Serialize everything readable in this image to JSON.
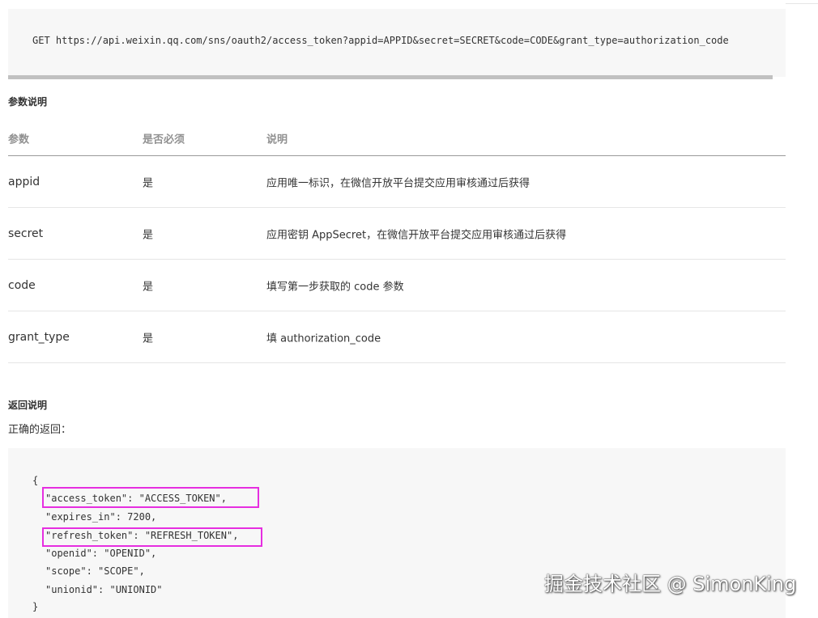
{
  "request": {
    "line": "GET https://api.weixin.qq.com/sns/oauth2/access_token?appid=APPID&secret=SECRET&code=CODE&grant_type=authorization_code"
  },
  "params_section": {
    "title": "参数说明",
    "headers": [
      "参数",
      "是否必须",
      "说明"
    ],
    "rows": [
      {
        "param": "appid",
        "required": "是",
        "desc": "应用唯一标识，在微信开放平台提交应用审核通过后获得"
      },
      {
        "param": "secret",
        "required": "是",
        "desc": "应用密钥 AppSecret，在微信开放平台提交应用审核通过后获得"
      },
      {
        "param": "code",
        "required": "是",
        "desc": "填写第一步获取的 code 参数"
      },
      {
        "param": "grant_type",
        "required": "是",
        "desc": "填 authorization_code"
      }
    ]
  },
  "return_section": {
    "title": "返回说明",
    "subtitle": "正确的返回："
  },
  "json_response": {
    "lines": [
      "{",
      "\"access_token\": \"ACCESS_TOKEN\",",
      "\"expires_in\": 7200,",
      "\"refresh_token\": \"REFRESH_TOKEN\",",
      "\"openid\": \"OPENID\",",
      "\"scope\": \"SCOPE\",",
      "\"unionid\": \"UNIONID\"",
      "}"
    ]
  },
  "watermark": {
    "text": "掘金技术社区 @ SimonKing"
  },
  "colors": {
    "highlight": "#e62ee0",
    "code_bg": "#f7f7f7"
  }
}
